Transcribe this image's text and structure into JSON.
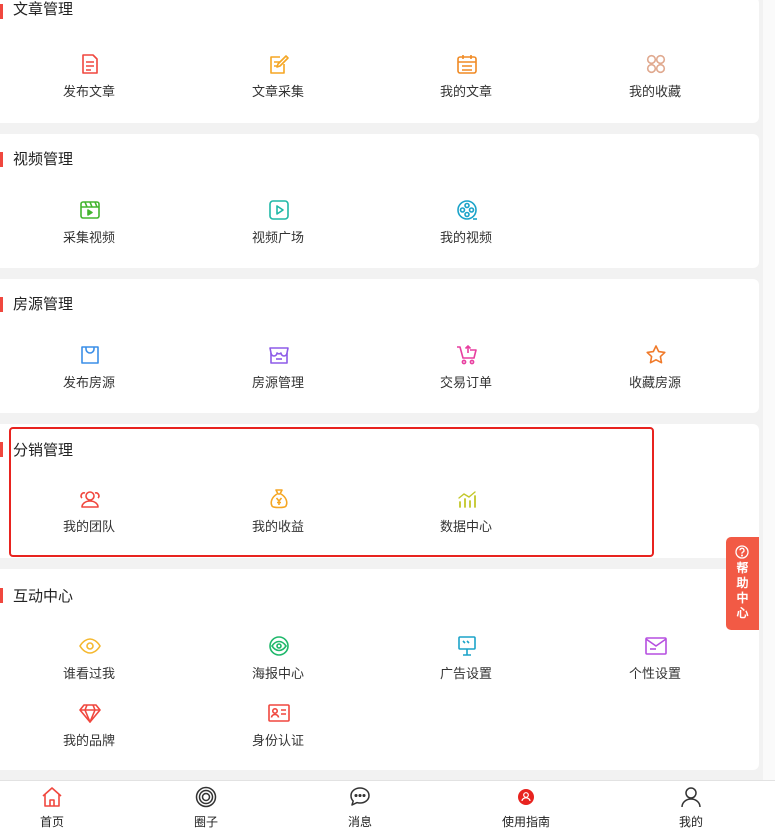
{
  "sections": [
    {
      "title": "文章管理",
      "items": [
        {
          "label": "发布文章",
          "icon": "document-icon",
          "color": "#f0473e"
        },
        {
          "label": "文章采集",
          "icon": "edit-note-icon",
          "color": "#f5a623"
        },
        {
          "label": "我的文章",
          "icon": "calendar-list-icon",
          "color": "#f08a24"
        },
        {
          "label": "我的收藏",
          "icon": "clover-icon",
          "color": "#e0a98f"
        }
      ]
    },
    {
      "title": "视频管理",
      "items": [
        {
          "label": "采集视频",
          "icon": "film-icon",
          "color": "#43b52f"
        },
        {
          "label": "视频广场",
          "icon": "play-square-icon",
          "color": "#1fb8a6"
        },
        {
          "label": "我的视频",
          "icon": "film-reel-icon",
          "color": "#1ba3c9"
        }
      ]
    },
    {
      "title": "房源管理",
      "items": [
        {
          "label": "发布房源",
          "icon": "bag-icon",
          "color": "#3b8fe8"
        },
        {
          "label": "房源管理",
          "icon": "store-icon",
          "color": "#8e5ce8"
        },
        {
          "label": "交易订单",
          "icon": "cart-icon",
          "color": "#e83fa0"
        },
        {
          "label": "收藏房源",
          "icon": "star-icon",
          "color": "#f07a2a"
        }
      ]
    },
    {
      "title": "分销管理",
      "items": [
        {
          "label": "我的团队",
          "icon": "team-icon",
          "color": "#f0473e"
        },
        {
          "label": "我的收益",
          "icon": "money-bag-icon",
          "color": "#f5a623"
        },
        {
          "label": "数据中心",
          "icon": "bar-chart-icon",
          "color": "#c3c72a"
        }
      ]
    },
    {
      "title": "互动中心",
      "items": [
        {
          "label": "谁看过我",
          "icon": "eye-icon",
          "color": "#f5b82e"
        },
        {
          "label": "海报中心",
          "icon": "eye-circle-icon",
          "color": "#1fb86b"
        },
        {
          "label": "广告设置",
          "icon": "billboard-icon",
          "color": "#1ba3c9"
        },
        {
          "label": "个性设置",
          "icon": "mail-icon",
          "color": "#b64fe0"
        },
        {
          "label": "我的品牌",
          "icon": "diamond-icon",
          "color": "#f0473e"
        },
        {
          "label": "身份认证",
          "icon": "id-card-icon",
          "color": "#f0473e"
        }
      ]
    }
  ],
  "help": {
    "text": "帮助中心",
    "chars": [
      "帮",
      "助",
      "中",
      "心"
    ],
    "color": "#f25a45"
  },
  "tabs": [
    {
      "label": "首页",
      "icon": "home-icon",
      "color": "#f0473e"
    },
    {
      "label": "圈子",
      "icon": "circles-icon",
      "color": "#333333"
    },
    {
      "label": "消息",
      "icon": "chat-icon",
      "color": "#333333"
    },
    {
      "label": "使用指南",
      "icon": "guide-icon",
      "color": "#e8231f"
    },
    {
      "label": "我的",
      "icon": "user-icon",
      "color": "#333333"
    }
  ],
  "colors": {
    "accent": "#f0473e",
    "highlight": "#e8231f",
    "background": "#f2f2f2"
  }
}
